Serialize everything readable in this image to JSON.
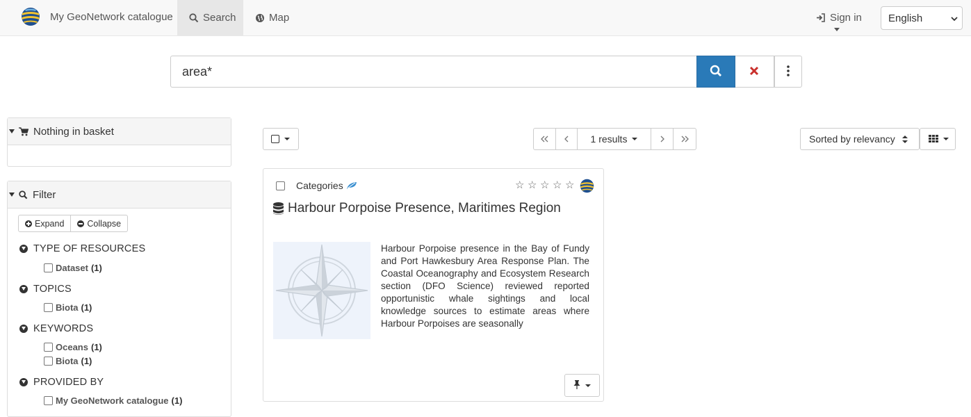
{
  "app": {
    "title": "My GeoNetwork catalogue",
    "colors": {
      "primary": "#2a7ab8",
      "clear": "#c9302c",
      "navbar": "#f8f8f8"
    }
  },
  "nav": {
    "tabs": [
      {
        "label": "Search",
        "icon": "search-icon",
        "active": true
      },
      {
        "label": "Map",
        "icon": "globe-icon",
        "active": false
      }
    ],
    "signin_label": "Sign in",
    "language": "English"
  },
  "search": {
    "query": "area*",
    "buttons": [
      "search-icon",
      "clear-icon",
      "more-vertical-icon"
    ]
  },
  "sidebar": {
    "basket": {
      "title": "Nothing in basket",
      "icon": "cart-icon"
    },
    "filter": {
      "title": "Filter",
      "expand_label": "Expand",
      "collapse_label": "Collapse",
      "facets": [
        {
          "title": "TYPE OF RESOURCES",
          "items": [
            {
              "label": "Dataset",
              "count": "(1)"
            }
          ]
        },
        {
          "title": "TOPICS",
          "items": [
            {
              "label": "Biota",
              "count": "(1)"
            }
          ]
        },
        {
          "title": "KEYWORDS",
          "items": [
            {
              "label": "Oceans",
              "count": "(1)"
            },
            {
              "label": "Biota",
              "count": "(1)"
            }
          ]
        },
        {
          "title": "PROVIDED BY",
          "items": [
            {
              "label": "My GeoNetwork catalogue",
              "count": "(1)"
            }
          ]
        }
      ]
    }
  },
  "results": {
    "count_label": "1 results",
    "sort_label": "Sorted by relevancy",
    "items": [
      {
        "categories_label": "Categories",
        "rating_stars": 5,
        "title": "Harbour Porpoise Presence, Maritimes Region",
        "abstract": "Harbour Porpoise presence in the Bay of Fundy and Port Hawkesbury Area Response Plan. The Coastal Oceanography and Ecosystem Research section (DFO Science) reviewed reported opportunistic whale sightings and local knowledge sources to estimate areas where Harbour Porpoises are seasonally"
      }
    ]
  }
}
